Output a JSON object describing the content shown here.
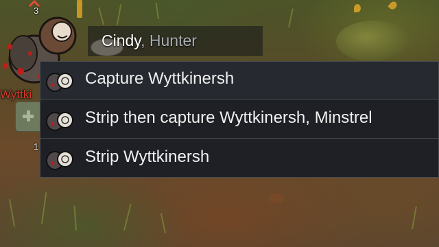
{
  "scene": {
    "pawn": {
      "name_label": "Wyttki",
      "stack_count_top": "3",
      "stack_count_bottom": "1"
    },
    "tooltip": {
      "pawn_name": "Cindy",
      "separator": ", ",
      "role": "Hunter"
    }
  },
  "context_menu": {
    "items": [
      {
        "label": "Capture Wyttkinersh",
        "icon": "prisoner-capture-icon"
      },
      {
        "label": "Strip then capture Wyttkinersh, Minstrel",
        "icon": "prisoner-capture-icon"
      },
      {
        "label": "Strip Wyttkinersh",
        "icon": "prisoner-capture-icon"
      }
    ]
  },
  "colors": {
    "menu_bg": "#1e2025",
    "menu_border": "#4a4d52",
    "menu_text": "#f0f0f0",
    "hostile_label": "#d33b2d",
    "role_text": "#a9adb2"
  }
}
